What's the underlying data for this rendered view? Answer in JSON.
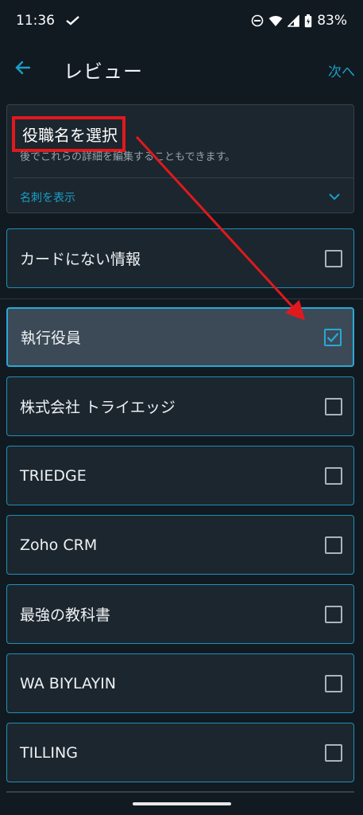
{
  "status_bar": {
    "time": "11:36",
    "battery": "83%",
    "icons": [
      "check-icon",
      "dnd-icon",
      "wifi-icon",
      "signal-icon",
      "battery-icon"
    ]
  },
  "app_bar": {
    "title": "レビュー",
    "next_label": "次へ",
    "back_icon": "back-arrow-icon"
  },
  "info_card": {
    "title": "役職名を選択",
    "subtitle": "後でこれらの詳細を編集することもできます。",
    "show_card_label": "名刺を表示"
  },
  "items": [
    {
      "label": "カードにない情報",
      "checked": false
    },
    {
      "label": "執行役員",
      "checked": true
    },
    {
      "label": "株式会社 トライエッジ",
      "checked": false
    },
    {
      "label": "TRIEDGE",
      "checked": false
    },
    {
      "label": "Zoho CRM",
      "checked": false
    },
    {
      "label": "最強の教科書",
      "checked": false
    },
    {
      "label": "WA BIYLAYIN",
      "checked": false
    },
    {
      "label": "TILLING",
      "checked": false
    }
  ],
  "colors": {
    "background": "#121a21",
    "card": "#1c262e",
    "accent": "#1a9fc8",
    "selected": "#3c4a57",
    "annotation": "#e0191e"
  }
}
